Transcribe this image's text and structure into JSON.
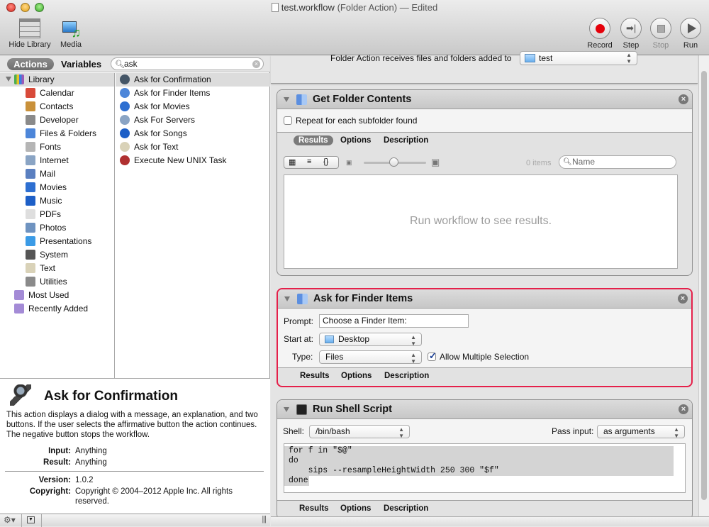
{
  "window": {
    "title": "test.workflow",
    "subtitle": "(Folder Action) — Edited"
  },
  "toolbar": {
    "hide_library": "Hide Library",
    "media": "Media",
    "record": "Record",
    "step": "Step",
    "stop": "Stop",
    "run": "Run"
  },
  "library": {
    "tab_actions": "Actions",
    "tab_variables": "Variables",
    "search_value": "ask",
    "root": "Library",
    "categories": [
      {
        "label": "Calendar",
        "color": "#d84a3a"
      },
      {
        "label": "Contacts",
        "color": "#c9913a"
      },
      {
        "label": "Developer",
        "color": "#8a8a8a"
      },
      {
        "label": "Files & Folders",
        "color": "#4d86d9"
      },
      {
        "label": "Fonts",
        "color": "#b5b5b5"
      },
      {
        "label": "Internet",
        "color": "#8aa4c4"
      },
      {
        "label": "Mail",
        "color": "#5a7fc0"
      },
      {
        "label": "Movies",
        "color": "#2e6fd1"
      },
      {
        "label": "Music",
        "color": "#1d5fc7"
      },
      {
        "label": "PDFs",
        "color": "#dedede"
      },
      {
        "label": "Photos",
        "color": "#6f93c0"
      },
      {
        "label": "Presentations",
        "color": "#3b9be6"
      },
      {
        "label": "System",
        "color": "#555555"
      },
      {
        "label": "Text",
        "color": "#d9d2b8"
      },
      {
        "label": "Utilities",
        "color": "#8a8a8a"
      }
    ],
    "collections": [
      {
        "label": "Most Used",
        "color": "#a48bd6"
      },
      {
        "label": "Recently Added",
        "color": "#a48bd6"
      }
    ],
    "actions": [
      {
        "label": "Ask for Confirmation",
        "color": "#445566"
      },
      {
        "label": "Ask for Finder Items",
        "color": "#4d86d9"
      },
      {
        "label": "Ask for Movies",
        "color": "#2e6fd1"
      },
      {
        "label": "Ask For Servers",
        "color": "#8aa4c4"
      },
      {
        "label": "Ask for Songs",
        "color": "#1d5fc7"
      },
      {
        "label": "Ask for Text",
        "color": "#d9d2b8"
      },
      {
        "label": "Execute New UNIX Task",
        "color": "#b03030"
      }
    ]
  },
  "description": {
    "title": "Ask for Confirmation",
    "text": "This action displays a dialog with a message, an explanation, and two buttons. If the user selects the affirmative button the action continues. The negative button stops the workflow.",
    "input_label": "Input:",
    "input_value": "Anything",
    "result_label": "Result:",
    "result_value": "Anything",
    "version_label": "Version:",
    "version_value": "1.0.2",
    "copyright_label": "Copyright:",
    "copyright_value": "Copyright © 2004–2012 Apple Inc.  All rights reserved."
  },
  "workflow": {
    "folder_action_label": "Folder Action receives files and folders added to",
    "folder_value": "test",
    "tabs": {
      "results": "Results",
      "options": "Options",
      "description": "Description"
    },
    "get_folder_contents": {
      "title": "Get Folder Contents",
      "repeat_label": "Repeat for each subfolder found",
      "repeat_checked": false,
      "items_count": "0 items",
      "search_placeholder": "Name",
      "empty_message": "Run workflow to see results."
    },
    "ask_for_finder_items": {
      "title": "Ask for Finder Items",
      "prompt_label": "Prompt:",
      "prompt_value": "Choose a Finder Item:",
      "start_label": "Start at:",
      "start_value": "Desktop",
      "type_label": "Type:",
      "type_value": "Files",
      "multiple_label": "Allow Multiple Selection",
      "multiple_checked": true
    },
    "run_shell_script": {
      "title": "Run Shell Script",
      "shell_label": "Shell:",
      "shell_value": "/bin/bash",
      "pass_label": "Pass input:",
      "pass_value": "as arguments",
      "code": [
        "for f in \"$@\"",
        "do",
        "    sips --resampleHeightWidth 250 300 \"$f\"",
        "done"
      ]
    }
  }
}
